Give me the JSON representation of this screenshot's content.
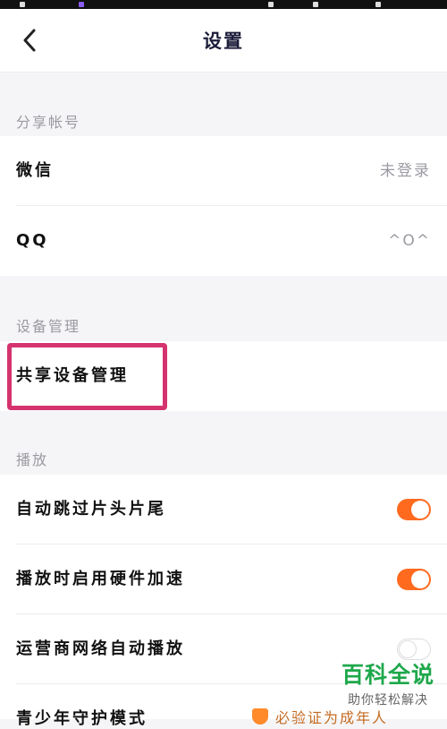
{
  "header": {
    "title": "设置"
  },
  "sections": {
    "share": {
      "label": "分享帐号"
    },
    "device": {
      "label": "设备管理"
    },
    "play": {
      "label": "播放"
    }
  },
  "rows": {
    "wechat": {
      "label": "微信",
      "value": "未登录"
    },
    "qq": {
      "label": "QQ",
      "value": "^O^"
    },
    "shared_device": {
      "label": "共享设备管理"
    },
    "auto_skip": {
      "label": "自动跳过片头片尾",
      "toggle": true
    },
    "hw_accel": {
      "label": "播放时启用硬件加速",
      "toggle": true
    },
    "carrier_autoplay": {
      "label": "运营商网络自动播放",
      "toggle": false
    },
    "partial": {
      "label": "青少年守护模式",
      "value": "必验证为成年人"
    }
  },
  "watermark": {
    "brand": "百科全说",
    "sub": "助你轻松解决"
  },
  "colors": {
    "accent": "#ff6a1f",
    "highlight": "#d5336f",
    "brand": "#1ea84b"
  }
}
